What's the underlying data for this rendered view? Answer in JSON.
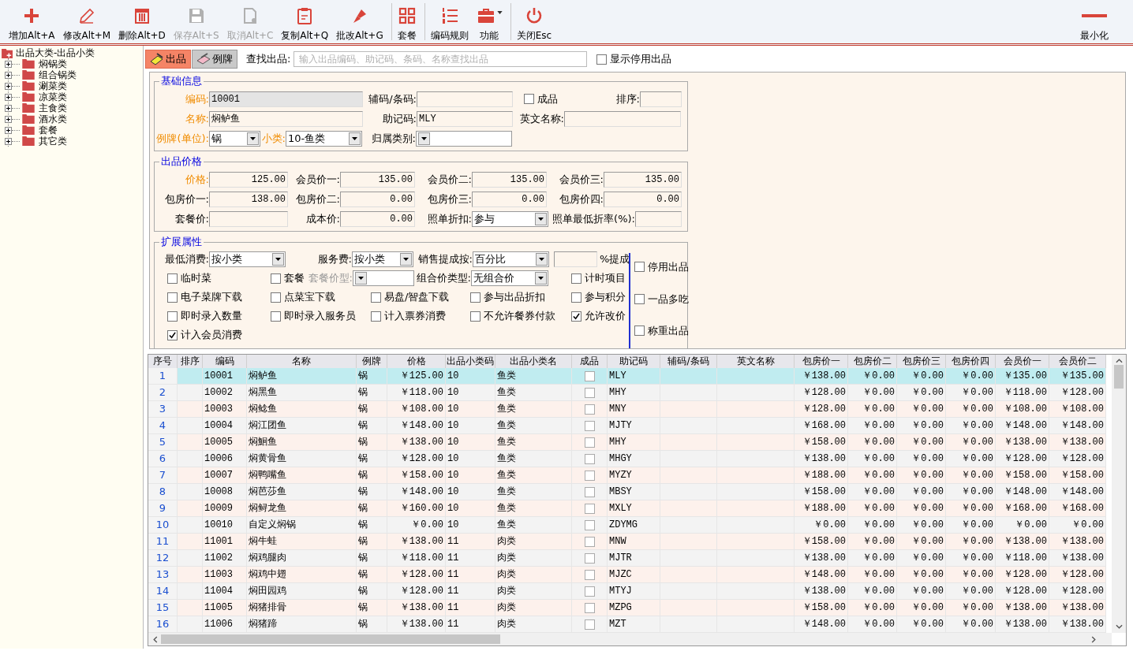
{
  "toolbar": [
    {
      "label": "增加Alt+A",
      "disabled": false,
      "dropdown": false,
      "separator_before": false
    },
    {
      "label": "修改Alt+M",
      "disabled": false,
      "dropdown": false,
      "separator_before": false
    },
    {
      "label": "删除Alt+D",
      "disabled": false,
      "dropdown": false,
      "separator_before": false
    },
    {
      "label": "保存Alt+S",
      "disabled": true,
      "dropdown": false,
      "separator_before": false
    },
    {
      "label": "取消Alt+C",
      "disabled": true,
      "dropdown": false,
      "separator_before": false
    },
    {
      "label": "复制Alt+Q",
      "disabled": false,
      "dropdown": false,
      "separator_before": false
    },
    {
      "label": "批改Alt+G",
      "disabled": false,
      "dropdown": false,
      "separator_before": false
    },
    {
      "label": "套餐",
      "disabled": false,
      "dropdown": false,
      "separator_before": true
    },
    {
      "label": "编码规则",
      "disabled": false,
      "dropdown": false,
      "separator_before": true
    },
    {
      "label": "功能",
      "disabled": false,
      "dropdown": true,
      "separator_before": false
    },
    {
      "label": "关闭Esc",
      "disabled": false,
      "dropdown": false,
      "separator_before": true
    }
  ],
  "minimize_button": {
    "label": "最小化"
  },
  "tree": {
    "label": "出品大类-出品小类",
    "children": [
      {
        "label": "焖锅类",
        "expanded": false
      },
      {
        "label": "组合锅类",
        "expanded": false
      },
      {
        "label": "涮菜类",
        "expanded": false
      },
      {
        "label": "凉菜类",
        "expanded": false
      },
      {
        "label": "主食类",
        "expanded": false
      },
      {
        "label": "酒水类",
        "expanded": false
      },
      {
        "label": "套餐",
        "expanded": false
      },
      {
        "label": "其它类",
        "expanded": false
      }
    ]
  },
  "tabs": [
    {
      "label": "出品",
      "selected": true
    },
    {
      "label": "例牌",
      "selected": false
    }
  ],
  "search": {
    "label": "查找出品:",
    "placeholder": "输入出品编码、助记码、条码、名称查找出品"
  },
  "show_disabled": {
    "label": "显示停用出品",
    "checked": false
  },
  "groups": [
    {
      "title": "基础信息",
      "rows": [
        {
          "fields": [
            {
              "kind": "text",
              "label": "编码:",
              "value": "10001",
              "required": true,
              "readonly": true
            },
            {
              "kind": "text",
              "label": "辅码/条码:",
              "required": false,
              "readonly": false
            },
            {
              "kind": "check",
              "label": "成品",
              "checked": false
            },
            {
              "kind": "text",
              "label": "排序:",
              "required": false,
              "readonly": false
            }
          ]
        },
        {
          "fields": [
            {
              "kind": "text",
              "label": "名称:",
              "value": "焖鲈鱼",
              "required": true,
              "readonly": false
            },
            {
              "kind": "text",
              "label": "助记码:",
              "value": "MLY",
              "required": false,
              "readonly": false
            },
            {
              "kind": "text",
              "label": "英文名称:",
              "required": false,
              "readonly": false
            }
          ]
        },
        {
          "fields": [
            {
              "kind": "select",
              "label": "例牌(单位):",
              "value": "锅",
              "required": true,
              "disabled": false
            },
            {
              "kind": "select",
              "label": "小类:",
              "value": "10-鱼类",
              "required": true,
              "disabled": false
            },
            {
              "kind": "select",
              "label": "归属类别:",
              "required": false,
              "disabled": false
            }
          ]
        }
      ]
    },
    {
      "title": "出品价格",
      "rows": [
        {
          "fields": [
            {
              "kind": "text",
              "label": "价格:",
              "value": "125.00",
              "required": true,
              "readonly": false
            },
            {
              "kind": "text",
              "label": "会员价一:",
              "value": "135.00",
              "required": false,
              "readonly": false
            },
            {
              "kind": "text",
              "label": "会员价二:",
              "value": "135.00",
              "required": false,
              "readonly": false
            },
            {
              "kind": "text",
              "label": "会员价三:",
              "value": "135.00",
              "required": false,
              "readonly": false
            }
          ]
        },
        {
          "fields": [
            {
              "kind": "text",
              "label": "包房价一:",
              "value": "138.00",
              "required": false,
              "readonly": false
            },
            {
              "kind": "text",
              "label": "包房价二:",
              "value": "0.00",
              "required": false,
              "readonly": false
            },
            {
              "kind": "text",
              "label": "包房价三:",
              "value": "0.00",
              "required": false,
              "readonly": false
            },
            {
              "kind": "text",
              "label": "包房价四:",
              "value": "0.00",
              "required": false,
              "readonly": false
            }
          ]
        },
        {
          "fields": [
            {
              "kind": "text",
              "label": "套餐价:",
              "required": false,
              "readonly": false
            },
            {
              "kind": "text",
              "label": "成本价:",
              "value": "0.00",
              "required": false,
              "readonly": false
            },
            {
              "kind": "select",
              "label": "照单折扣:",
              "value": "参与",
              "required": false,
              "disabled": false
            },
            {
              "kind": "text",
              "label": "照单最低折率(%):",
              "required": false,
              "readonly": false
            }
          ]
        }
      ]
    },
    {
      "title": "扩展属性",
      "rows": [
        {
          "fields": [
            {
              "kind": "select",
              "label": "最低消费:",
              "value": "按小类",
              "required": false,
              "disabled": false
            },
            {
              "kind": "select",
              "label": "服务费:",
              "value": "按小类",
              "required": false,
              "disabled": false
            },
            {
              "kind": "select",
              "label": "销售提成按:",
              "value": "百分比",
              "required": false,
              "disabled": false
            },
            {
              "kind": "text",
              "suffix": "%提成",
              "required": false,
              "readonly": false
            }
          ]
        },
        {
          "fields": [
            {
              "kind": "check",
              "label": "临时菜",
              "checked": false
            },
            {
              "kind": "check",
              "label": "套餐",
              "checked": false
            },
            {
              "kind": "select",
              "label": "套餐价型:",
              "required": false,
              "disabled": true
            },
            {
              "kind": "select",
              "label": "组合价类型:",
              "value": "无组合价",
              "required": false,
              "disabled": false
            },
            {
              "kind": "check",
              "label": "计时项目",
              "checked": false
            }
          ]
        },
        {
          "fields": [
            {
              "kind": "check",
              "label": "电子菜牌下载",
              "checked": false
            },
            {
              "kind": "check",
              "label": "点菜宝下载",
              "checked": false
            },
            {
              "kind": "check",
              "label": "易盘/智盘下载",
              "checked": false
            },
            {
              "kind": "check",
              "label": "参与出品折扣",
              "checked": false
            },
            {
              "kind": "check",
              "label": "参与积分",
              "checked": false
            }
          ]
        },
        {
          "fields": [
            {
              "kind": "check",
              "label": "即时录入数量",
              "checked": false
            },
            {
              "kind": "check",
              "label": "即时录入服务员",
              "checked": false
            },
            {
              "kind": "check",
              "label": "计入票券消费",
              "checked": false
            },
            {
              "kind": "check",
              "label": "不允许餐券付款",
              "checked": false
            },
            {
              "kind": "check",
              "label": "允许改价",
              "checked": true
            }
          ]
        },
        {
          "fields": [
            {
              "kind": "check",
              "label": "计入会员消费",
              "checked": true
            }
          ]
        }
      ],
      "side_checks": [
        {
          "label": "停用出品",
          "checked": false
        },
        {
          "label": "一品多吃",
          "checked": false
        },
        {
          "label": "称重出品",
          "checked": false
        }
      ]
    }
  ],
  "table": {
    "columns": [
      {
        "label": "序号",
        "kind": "seq"
      },
      {
        "label": "排序",
        "kind": "text"
      },
      {
        "label": "编码",
        "kind": "text"
      },
      {
        "label": "名称",
        "kind": "text"
      },
      {
        "label": "例牌",
        "kind": "text"
      },
      {
        "label": "价格",
        "kind": "money"
      },
      {
        "label": "出品小类码",
        "kind": "text"
      },
      {
        "label": "出品小类名",
        "kind": "text"
      },
      {
        "label": "成品",
        "kind": "check"
      },
      {
        "label": "助记码",
        "kind": "text"
      },
      {
        "label": "辅码/条码",
        "kind": "text"
      },
      {
        "label": "英文名称",
        "kind": "text"
      },
      {
        "label": "包房价一",
        "kind": "money"
      },
      {
        "label": "包房价二",
        "kind": "money"
      },
      {
        "label": "包房价三",
        "kind": "money"
      },
      {
        "label": "包房价四",
        "kind": "money"
      },
      {
        "label": "会员价一",
        "kind": "money"
      },
      {
        "label": "会员价二",
        "kind": "money"
      }
    ],
    "rows": [
      {
        "selected": true,
        "cells": [
          "1",
          "",
          "10001",
          "焖鲈鱼",
          "锅",
          "￥125.00",
          "10",
          "鱼类",
          false,
          "MLY",
          "",
          "",
          "￥138.00",
          "￥0.00",
          "￥0.00",
          "￥0.00",
          "￥135.00",
          "￥135.00"
        ]
      },
      {
        "selected": false,
        "cells": [
          "2",
          "",
          "10002",
          "焖黑鱼",
          "锅",
          "￥118.00",
          "10",
          "鱼类",
          false,
          "MHY",
          "",
          "",
          "￥128.00",
          "￥0.00",
          "￥0.00",
          "￥0.00",
          "￥118.00",
          "￥128.00"
        ]
      },
      {
        "selected": false,
        "cells": [
          "3",
          "",
          "10003",
          "焖鲶鱼",
          "锅",
          "￥108.00",
          "10",
          "鱼类",
          false,
          "MNY",
          "",
          "",
          "￥128.00",
          "￥0.00",
          "￥0.00",
          "￥0.00",
          "￥108.00",
          "￥108.00"
        ]
      },
      {
        "selected": false,
        "cells": [
          "4",
          "",
          "10004",
          "焖江团鱼",
          "锅",
          "￥148.00",
          "10",
          "鱼类",
          false,
          "MJTY",
          "",
          "",
          "￥168.00",
          "￥0.00",
          "￥0.00",
          "￥0.00",
          "￥148.00",
          "￥148.00"
        ]
      },
      {
        "selected": false,
        "cells": [
          "5",
          "",
          "10005",
          "焖鮰鱼",
          "锅",
          "￥138.00",
          "10",
          "鱼类",
          false,
          "MHY",
          "",
          "",
          "￥158.00",
          "￥0.00",
          "￥0.00",
          "￥0.00",
          "￥138.00",
          "￥138.00"
        ]
      },
      {
        "selected": false,
        "cells": [
          "6",
          "",
          "10006",
          "焖黄骨鱼",
          "锅",
          "￥128.00",
          "10",
          "鱼类",
          false,
          "MHGY",
          "",
          "",
          "￥138.00",
          "￥0.00",
          "￥0.00",
          "￥0.00",
          "￥128.00",
          "￥128.00"
        ]
      },
      {
        "selected": false,
        "cells": [
          "7",
          "",
          "10007",
          "焖鸭嘴鱼",
          "锅",
          "￥158.00",
          "10",
          "鱼类",
          false,
          "MYZY",
          "",
          "",
          "￥188.00",
          "￥0.00",
          "￥0.00",
          "￥0.00",
          "￥158.00",
          "￥158.00"
        ]
      },
      {
        "selected": false,
        "cells": [
          "8",
          "",
          "10008",
          "焖芭莎鱼",
          "锅",
          "￥148.00",
          "10",
          "鱼类",
          false,
          "MBSY",
          "",
          "",
          "￥158.00",
          "￥0.00",
          "￥0.00",
          "￥0.00",
          "￥148.00",
          "￥148.00"
        ]
      },
      {
        "selected": false,
        "cells": [
          "9",
          "",
          "10009",
          "焖鲟龙鱼",
          "锅",
          "￥160.00",
          "10",
          "鱼类",
          false,
          "MXLY",
          "",
          "",
          "￥188.00",
          "￥0.00",
          "￥0.00",
          "￥0.00",
          "￥168.00",
          "￥168.00"
        ]
      },
      {
        "selected": false,
        "cells": [
          "10",
          "",
          "10010",
          "自定义焖锅",
          "锅",
          "￥0.00",
          "10",
          "鱼类",
          false,
          "ZDYMG",
          "",
          "",
          "￥0.00",
          "￥0.00",
          "￥0.00",
          "￥0.00",
          "￥0.00",
          "￥0.00"
        ]
      },
      {
        "selected": false,
        "cells": [
          "11",
          "",
          "11001",
          "焖牛蛙",
          "锅",
          "￥138.00",
          "11",
          "肉类",
          false,
          "MNW",
          "",
          "",
          "￥158.00",
          "￥0.00",
          "￥0.00",
          "￥0.00",
          "￥138.00",
          "￥138.00"
        ]
      },
      {
        "selected": false,
        "cells": [
          "12",
          "",
          "11002",
          "焖鸡腿肉",
          "锅",
          "￥118.00",
          "11",
          "肉类",
          false,
          "MJTR",
          "",
          "",
          "￥138.00",
          "￥0.00",
          "￥0.00",
          "￥0.00",
          "￥118.00",
          "￥138.00"
        ]
      },
      {
        "selected": false,
        "cells": [
          "13",
          "",
          "11003",
          "焖鸡中翅",
          "锅",
          "￥128.00",
          "11",
          "肉类",
          false,
          "MJZC",
          "",
          "",
          "￥148.00",
          "￥0.00",
          "￥0.00",
          "￥0.00",
          "￥128.00",
          "￥128.00"
        ]
      },
      {
        "selected": false,
        "cells": [
          "14",
          "",
          "11004",
          "焖田园鸡",
          "锅",
          "￥128.00",
          "11",
          "肉类",
          false,
          "MTYJ",
          "",
          "",
          "￥138.00",
          "￥0.00",
          "￥0.00",
          "￥0.00",
          "￥128.00",
          "￥128.00"
        ]
      },
      {
        "selected": false,
        "cells": [
          "15",
          "",
          "11005",
          "焖猪排骨",
          "锅",
          "￥138.00",
          "11",
          "肉类",
          false,
          "MZPG",
          "",
          "",
          "￥158.00",
          "￥0.00",
          "￥0.00",
          "￥0.00",
          "￥138.00",
          "￥138.00"
        ]
      },
      {
        "selected": false,
        "cells": [
          "16",
          "",
          "11006",
          "焖猪蹄",
          "锅",
          "￥138.00",
          "11",
          "肉类",
          false,
          "MZT",
          "",
          "",
          "￥148.00",
          "￥0.00",
          "￥0.00",
          "￥0.00",
          "￥138.00",
          "￥138.00"
        ]
      }
    ]
  }
}
